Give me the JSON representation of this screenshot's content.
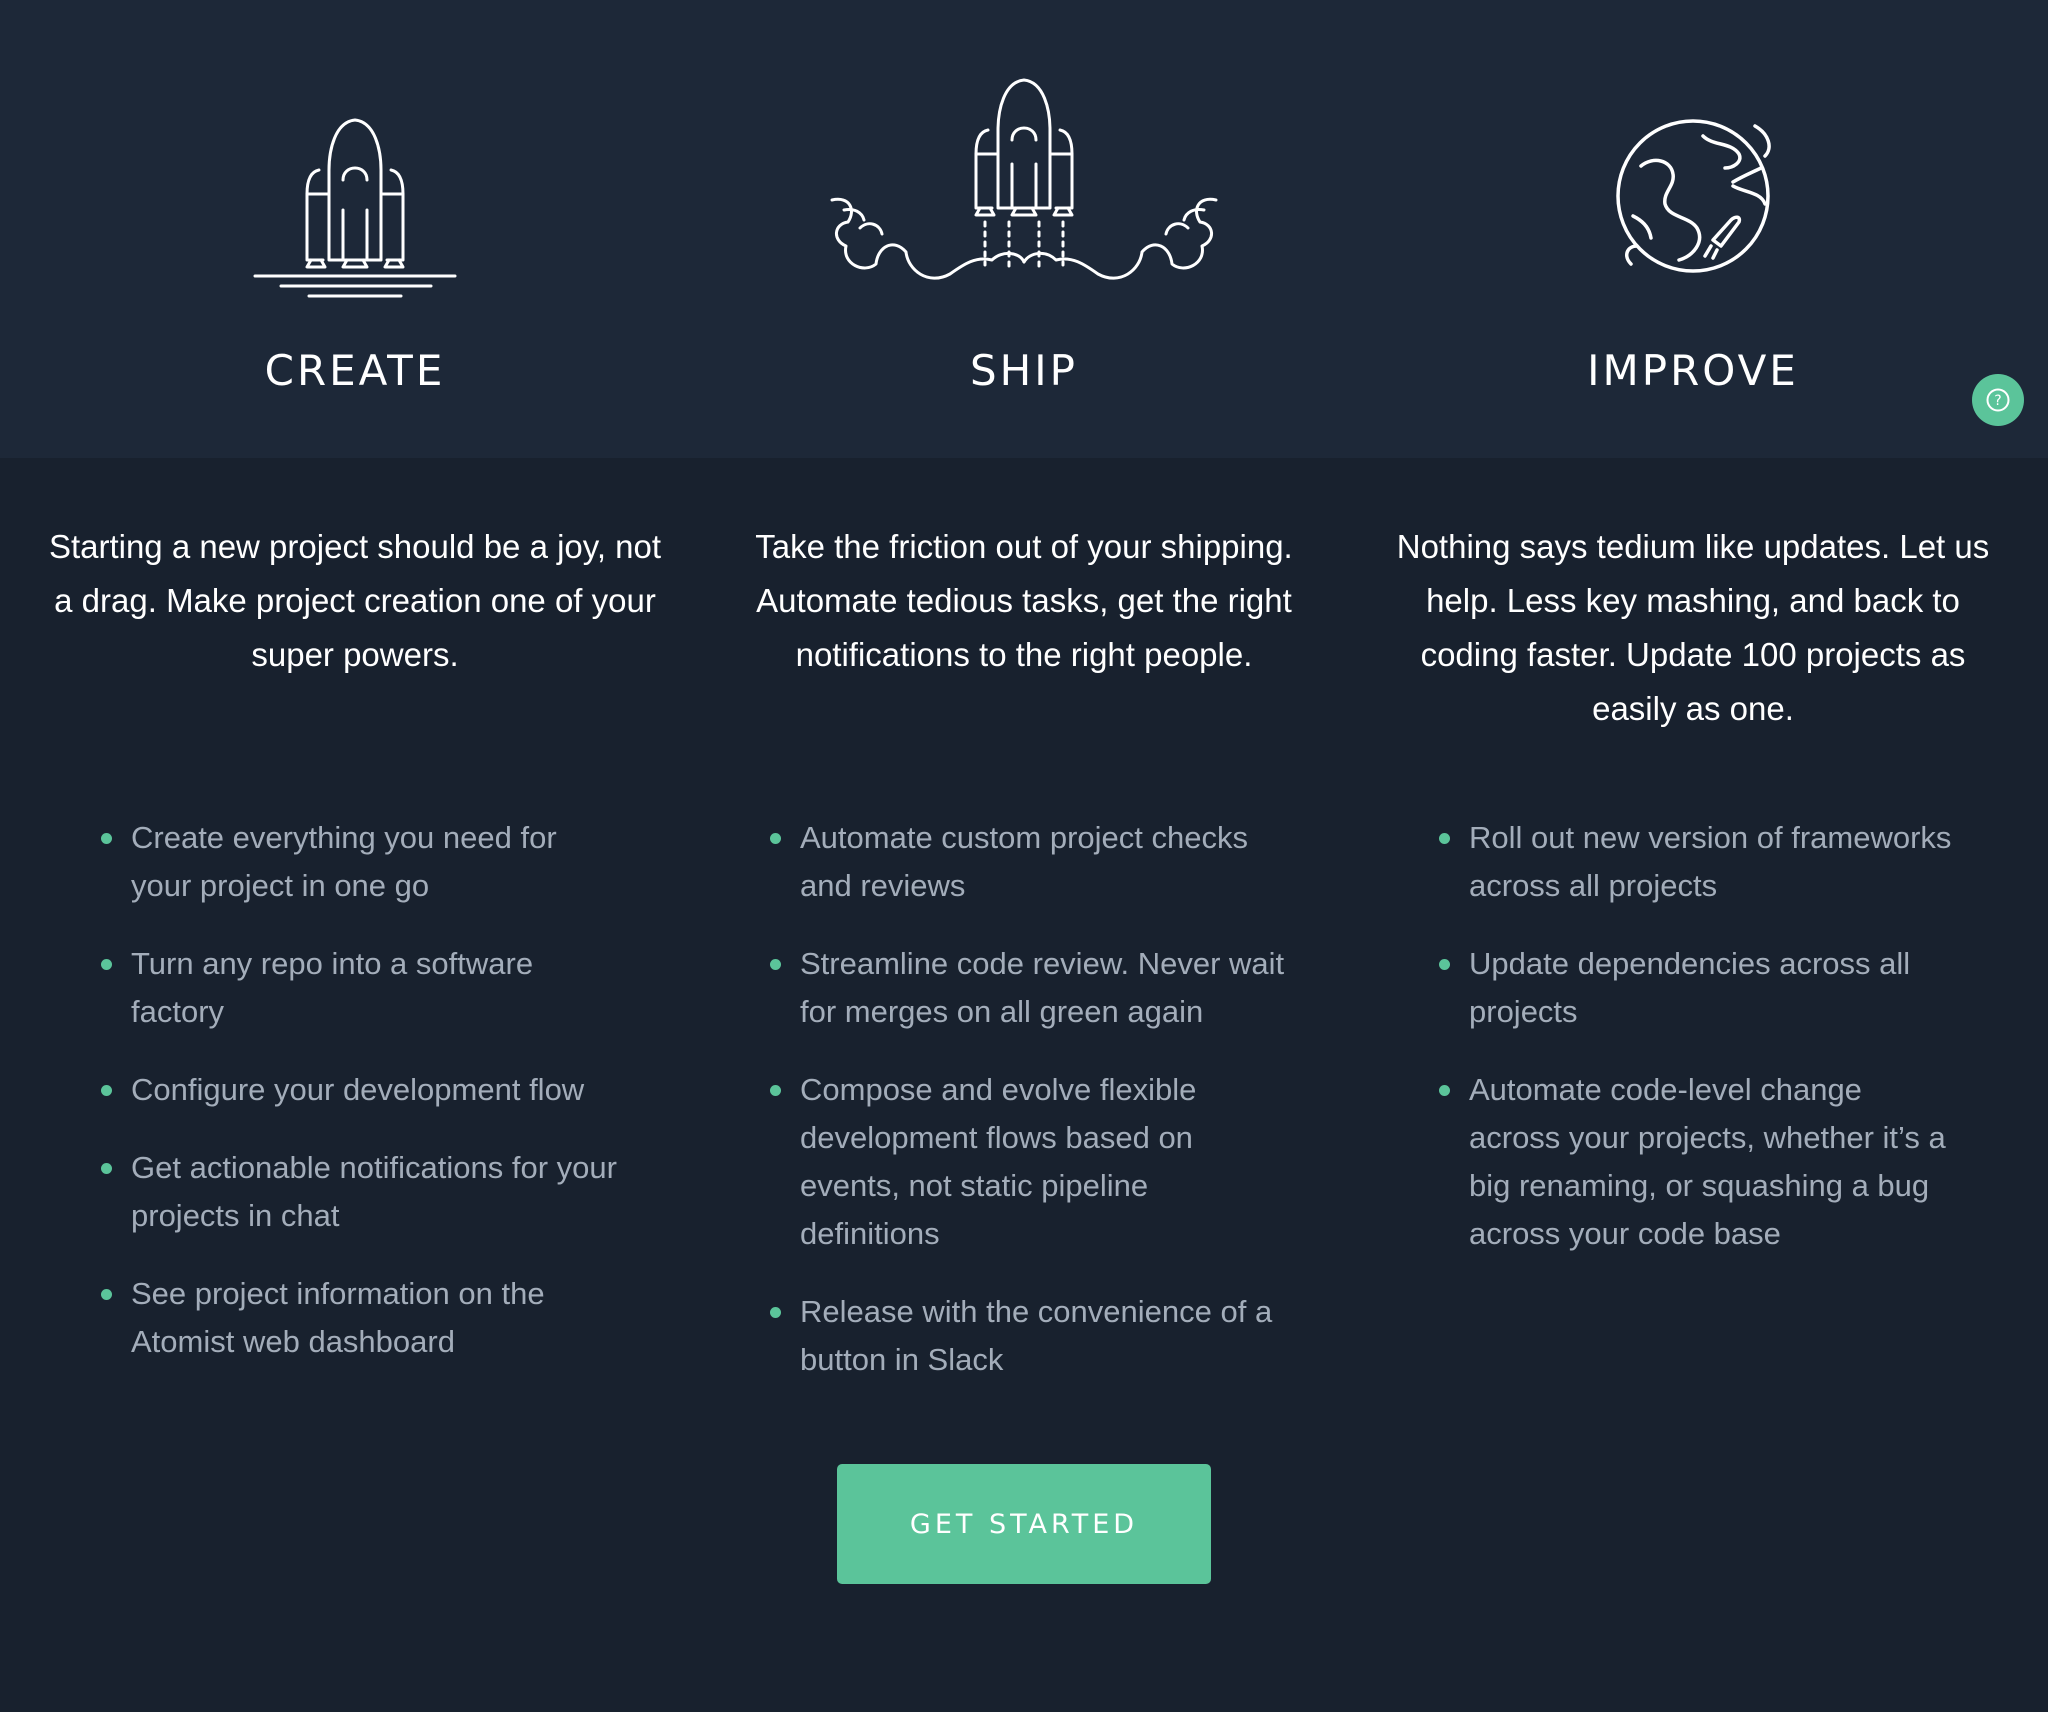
{
  "colors": {
    "background": "#18212e",
    "top_band": "#1d2838",
    "accent": "#5bc49a",
    "body_text": "#a3adba",
    "heading_text": "#ffffff"
  },
  "columns": [
    {
      "icon": "shuttle-on-pad-icon",
      "title": "CREATE",
      "description": "Starting a new project should be a joy, not a drag. Make project creation one of your super powers.",
      "features": [
        "Create everything you need for your project in one go",
        "Turn any repo into a software factory",
        "Configure your development flow",
        "Get actionable notifications for your projects in chat",
        "See project information on the Atomist web dashboard"
      ]
    },
    {
      "icon": "shuttle-launch-icon",
      "title": "SHIP",
      "description": "Take the friction out of your shipping. Automate tedious tasks, get the right notifications to the right people.",
      "features": [
        "Automate custom project checks and reviews",
        "Streamline code review. Never wait for merges on all green again",
        "Compose and evolve flexible development flows based on events, not static pipeline definitions",
        "Release with the convenience of a button in Slack"
      ]
    },
    {
      "icon": "globe-orbit-icon",
      "title": "IMPROVE",
      "description": "Nothing says tedium like updates. Let us help. Less key mashing, and back to coding faster. Update 100 projects as easily as one.",
      "features": [
        "Roll out new version of frameworks across all projects",
        "Update dependencies across all projects",
        "Automate code-level change across your projects, whether it’s a big renaming, or squashing a bug across your code base"
      ]
    }
  ],
  "cta": {
    "label": "GET STARTED"
  },
  "help": {
    "icon": "help-icon",
    "glyph": "?"
  }
}
